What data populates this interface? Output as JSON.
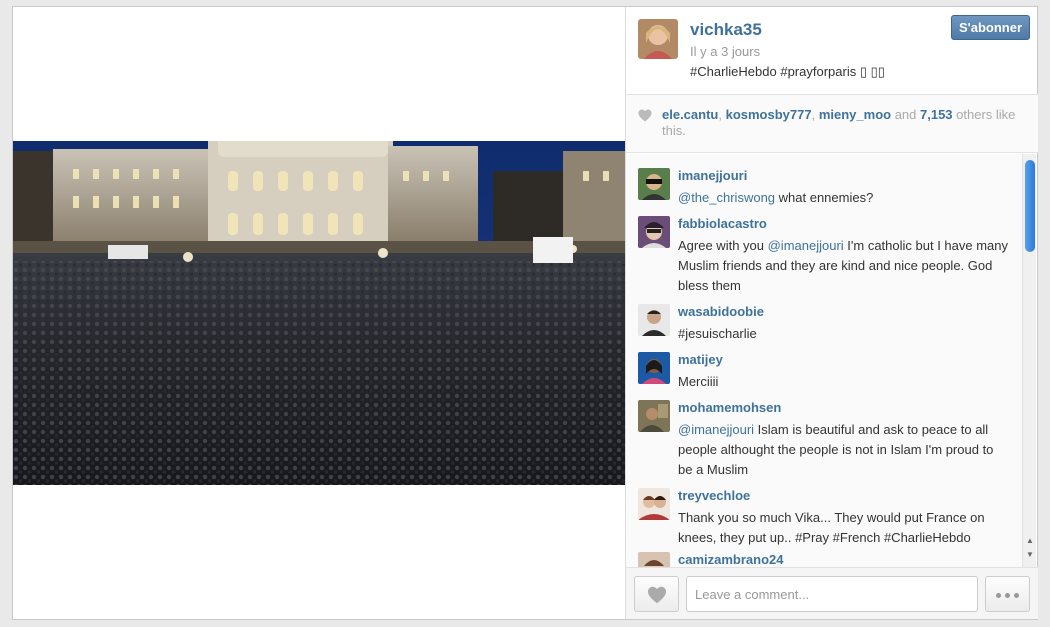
{
  "post": {
    "username": "vichka35",
    "time": "Il y a 3 jours",
    "caption": "#CharlieHebdo #prayforparis ▯ ▯▯",
    "follow_label": "S'abonner",
    "photo_alt": "crowd",
    "avatar_icon": "user-avatar"
  },
  "likes": {
    "users": [
      "ele.cantu",
      "kosmosby777",
      "mieny_moo"
    ],
    "and_text": " and ",
    "count": "7,153",
    "suffix": " others like this.",
    "icon": "heart-icon"
  },
  "comments": [
    {
      "user": "imanejjouri",
      "mention": "@the_chriswong",
      "text": " what ennemies?"
    },
    {
      "user": "fabbiolacastro",
      "pre": "Agree with you ",
      "mention": "@imanejjouri",
      "text": " I'm catholic but I have many Muslim friends and they are kind and nice people. God bless them"
    },
    {
      "user": "wasabidoobie",
      "text": "#jesuischarlie"
    },
    {
      "user": "matijey",
      "text": "Merciiii"
    },
    {
      "user": "mohamemohsen",
      "mention": "@imanejjouri",
      "text": " Islam is beautiful and ask to peace to all people althought the people is not in Islam I'm proud to be a Muslim"
    },
    {
      "user": "treyvechloe",
      "text": "Thank you so much Vika... They would put France on knees, they put up.. #Pray #French #CharlieHebdo"
    },
    {
      "user": "camizambrano24",
      "text": ""
    }
  ],
  "footer": {
    "comment_placeholder": "Leave a comment...",
    "like_icon": "heart-icon",
    "more_icon": "ellipsis-icon"
  },
  "colors": {
    "link": "#3f729b",
    "button": "#4f7aa6",
    "scroll_thumb": "#2a7ad8"
  }
}
